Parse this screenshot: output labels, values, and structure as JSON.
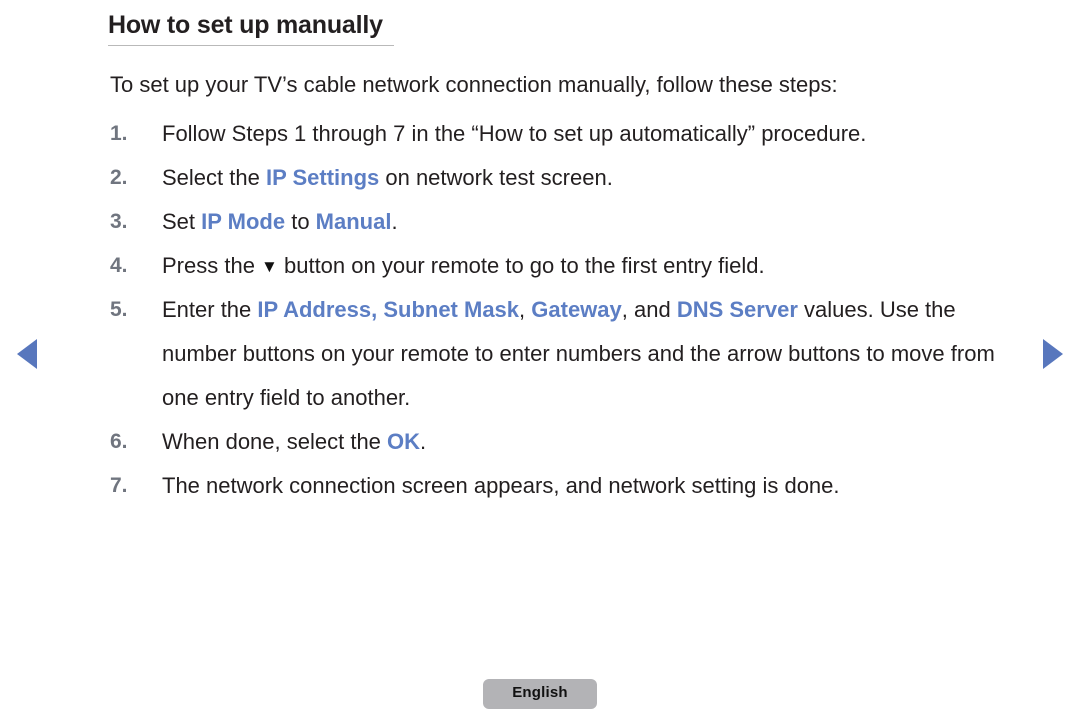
{
  "heading": {
    "title": "How to set up manually"
  },
  "intro": "To set up your TV’s cable network connection manually, follow these steps:",
  "steps": [
    {
      "num": "1.",
      "parts": [
        {
          "text": "Follow Steps 1 through 7 in the “How to set up automatically” procedure.",
          "style": "plain"
        }
      ]
    },
    {
      "num": "2.",
      "parts": [
        {
          "text": "Select the ",
          "style": "plain"
        },
        {
          "text": "IP Settings",
          "style": "keyword"
        },
        {
          "text": " on network test screen.",
          "style": "plain"
        }
      ]
    },
    {
      "num": "3.",
      "parts": [
        {
          "text": "Set ",
          "style": "plain"
        },
        {
          "text": "IP Mode",
          "style": "keyword"
        },
        {
          "text": " to ",
          "style": "plain"
        },
        {
          "text": "Manual",
          "style": "keyword"
        },
        {
          "text": ".",
          "style": "plain"
        }
      ]
    },
    {
      "num": "4.",
      "parts": [
        {
          "text": "Press the ",
          "style": "plain"
        },
        {
          "text": "▼",
          "style": "triangle-down"
        },
        {
          "text": " button on your remote to go to the first entry field.",
          "style": "plain"
        }
      ]
    },
    {
      "num": "5.",
      "parts": [
        {
          "text": "Enter the ",
          "style": "plain"
        },
        {
          "text": "IP Address, Subnet Mask",
          "style": "keyword"
        },
        {
          "text": ", ",
          "style": "plain"
        },
        {
          "text": "Gateway",
          "style": "keyword"
        },
        {
          "text": ", and ",
          "style": "plain"
        },
        {
          "text": "DNS Server",
          "style": "keyword"
        },
        {
          "text": " values. Use the number buttons on your remote to enter numbers and the arrow buttons to move from one entry field to another.",
          "style": "plain"
        }
      ]
    },
    {
      "num": "6.",
      "parts": [
        {
          "text": "When done, select the ",
          "style": "plain"
        },
        {
          "text": "OK",
          "style": "keyword"
        },
        {
          "text": ".",
          "style": "plain"
        }
      ]
    },
    {
      "num": "7.",
      "parts": [
        {
          "text": "The network connection screen appears, and network setting is done.",
          "style": "plain"
        }
      ]
    }
  ],
  "nav": {
    "prev_icon": "triangle-left-icon",
    "next_icon": "triangle-right-icon",
    "arrow_color": "#5877bd"
  },
  "footer": {
    "language_label": "English",
    "chip_color": "#b3b3b6"
  },
  "colors": {
    "keyword": "#5c7ec4",
    "step_number": "#70757f",
    "body_text": "#231f20",
    "rule": "#b9b9b9"
  }
}
